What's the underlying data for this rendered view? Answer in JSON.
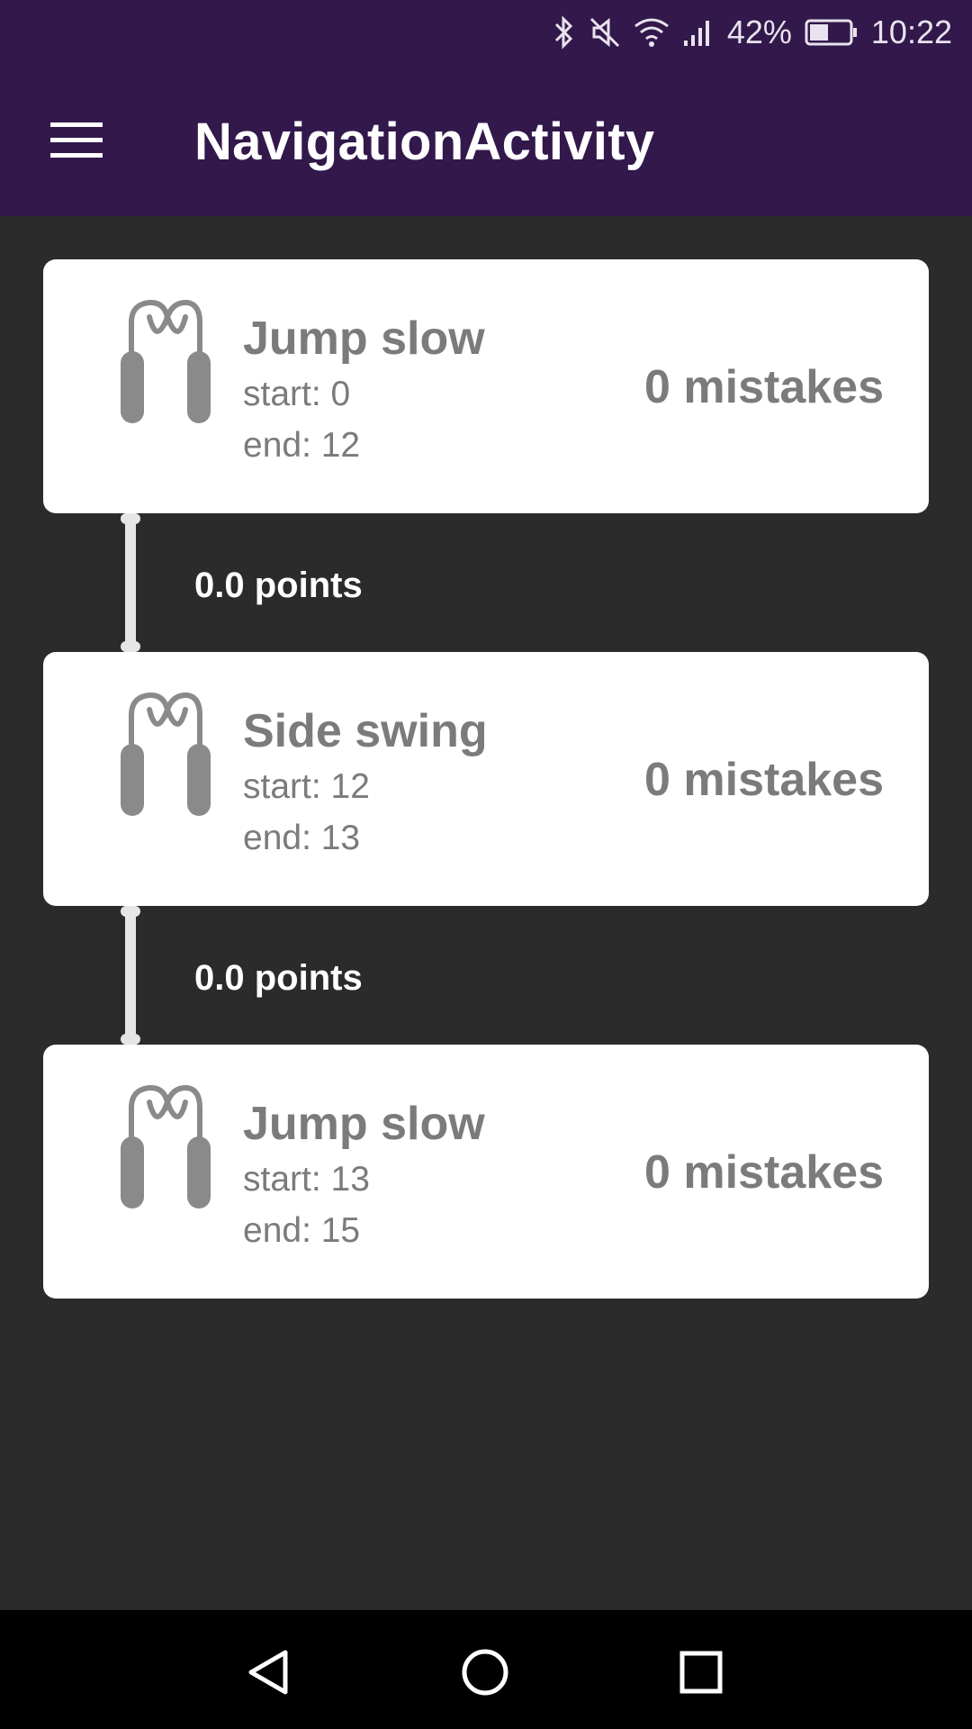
{
  "status_bar": {
    "battery_percent": "42%",
    "time": "10:22",
    "icons": [
      "bluetooth-icon",
      "mute-icon",
      "wifi-icon",
      "signal-icon",
      "battery-icon"
    ]
  },
  "app_bar": {
    "title": "NavigationActivity",
    "menu_icon": "hamburger-menu-icon"
  },
  "segments": [
    {
      "title": "Jump slow",
      "start": "start: 0",
      "end": "end: 12",
      "mistakes": "0 mistakes",
      "icon": "jump-rope-icon"
    },
    {
      "title": "Side swing",
      "start": "start: 12",
      "end": "end: 13",
      "mistakes": "0 mistakes",
      "icon": "jump-rope-icon"
    },
    {
      "title": "Jump slow",
      "start": "start: 13",
      "end": "end: 15",
      "mistakes": "0 mistakes",
      "icon": "jump-rope-icon"
    }
  ],
  "transitions": [
    {
      "points": "0.0 points"
    },
    {
      "points": "0.0 points"
    }
  ],
  "nav_bar": {
    "buttons": [
      "back-icon",
      "home-icon",
      "recents-icon"
    ]
  },
  "colors": {
    "primary": "#32184b",
    "background": "#2b2b2b",
    "card": "#ffffff",
    "card_text": "#7b7b7b",
    "connector": "#e6e6e6"
  }
}
